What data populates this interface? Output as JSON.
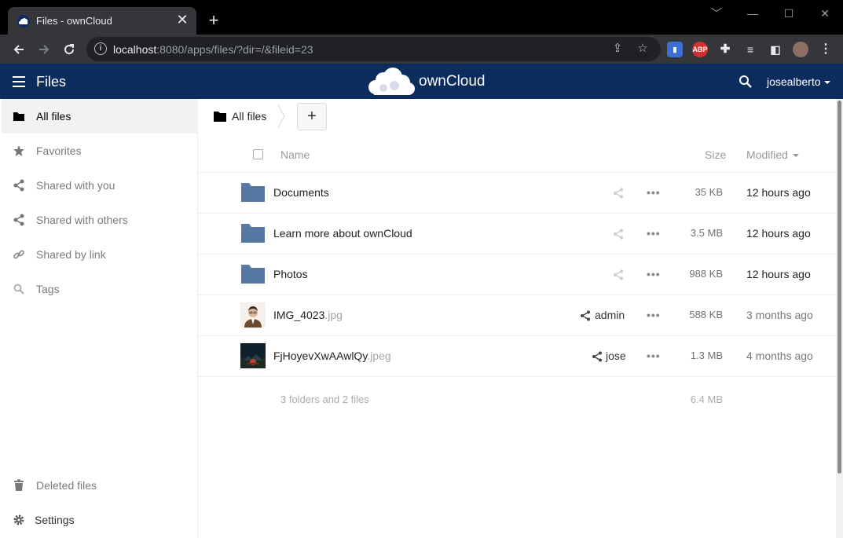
{
  "browser": {
    "tab_title": "Files - ownCloud",
    "tab_close": "✕",
    "new_tab": "+",
    "url_host": "localhost",
    "url_rest": ":8080/apps/files/?dir=/&fileid=23",
    "win_controls": [
      "﹀",
      "—",
      "☐",
      "✕"
    ]
  },
  "header": {
    "app_name": "Files",
    "logo_text": "ownCloud",
    "user": "josealberto"
  },
  "sidebar": {
    "items": [
      {
        "label": "All files",
        "icon": "folder-icon"
      },
      {
        "label": "Favorites",
        "icon": "star-icon"
      },
      {
        "label": "Shared with you",
        "icon": "share-icon"
      },
      {
        "label": "Shared with others",
        "icon": "share-icon"
      },
      {
        "label": "Shared by link",
        "icon": "link-icon"
      },
      {
        "label": "Tags",
        "icon": "search-icon"
      }
    ],
    "bottom": [
      {
        "label": "Deleted files",
        "icon": "trash-icon"
      },
      {
        "label": "Settings",
        "icon": "gear-icon"
      }
    ]
  },
  "breadcrumb": {
    "label": "All files",
    "new_button": "+"
  },
  "table": {
    "columns": {
      "name": "Name",
      "size": "Size",
      "modified": "Modified"
    },
    "rows": [
      {
        "name": "Documents",
        "ext": "",
        "type": "folder",
        "share_owner": "",
        "size": "35 KB",
        "modified": "12 hours ago"
      },
      {
        "name": "Learn more about ownCloud",
        "ext": "",
        "type": "folder",
        "share_owner": "",
        "size": "3.5 MB",
        "modified": "12 hours ago"
      },
      {
        "name": "Photos",
        "ext": "",
        "type": "folder",
        "share_owner": "",
        "size": "988 KB",
        "modified": "12 hours ago"
      },
      {
        "name": "IMG_4023",
        "ext": ".jpg",
        "type": "image",
        "share_owner": "admin",
        "size": "588 KB",
        "modified": "3 months ago"
      },
      {
        "name": "FjHoyevXwAAwlQy",
        "ext": ".jpeg",
        "type": "image",
        "share_owner": "jose",
        "size": "1.3 MB",
        "modified": "4 months ago"
      }
    ],
    "summary": "3 folders and 2 files",
    "summary_size": "6.4 MB",
    "more_label": "•••"
  },
  "colors": {
    "header_bg": "#0d2c5e",
    "folder": "#5b7ba6"
  }
}
